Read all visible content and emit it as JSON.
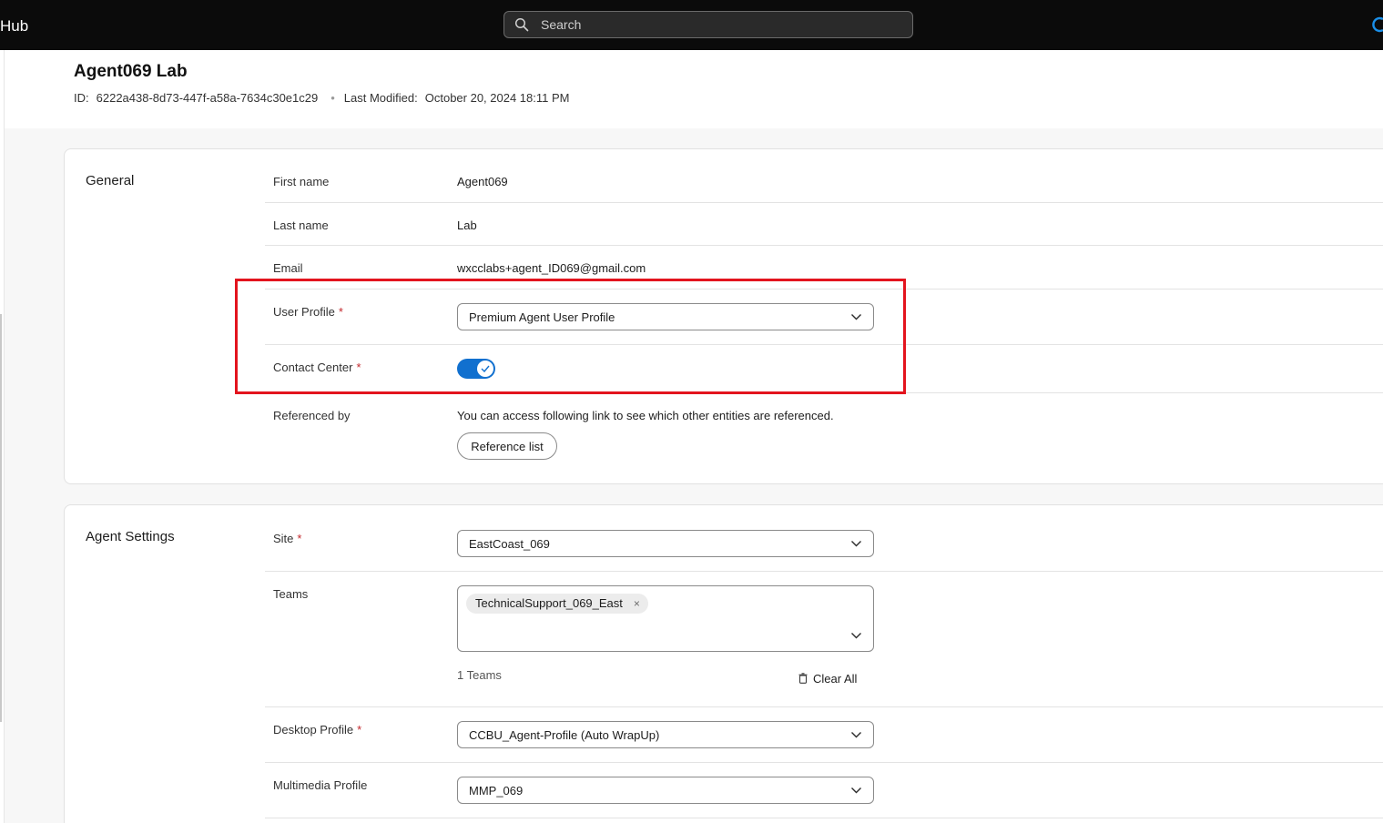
{
  "app": {
    "name": "Hub"
  },
  "search": {
    "placeholder": "Search"
  },
  "header": {
    "title": "Agent069 Lab",
    "id_label": "ID:",
    "id_value": "6222a438-8d73-447f-a58a-7634c30e1c29",
    "modified_label": "Last Modified:",
    "modified_value": "October 20, 2024 18:11 PM"
  },
  "general": {
    "title": "General",
    "first_name": {
      "label": "First name",
      "value": "Agent069"
    },
    "last_name": {
      "label": "Last name",
      "value": "Lab"
    },
    "email": {
      "label": "Email",
      "value": "wxcclabs+agent_ID069@gmail.com"
    },
    "user_profile": {
      "label": "User Profile",
      "required": "*",
      "value": "Premium Agent User Profile"
    },
    "contact_center": {
      "label": "Contact Center",
      "required": "*",
      "enabled": true
    },
    "referenced_by": {
      "label": "Referenced by",
      "text": "You can access following link to see which other entities are referenced.",
      "button": "Reference list"
    }
  },
  "agent_settings": {
    "title": "Agent Settings",
    "site": {
      "label": "Site",
      "required": "*",
      "value": "EastCoast_069"
    },
    "teams": {
      "label": "Teams",
      "chips": [
        "TechnicalSupport_069_East"
      ],
      "chip_remove": "×",
      "count": "1 Teams",
      "clear_all": "Clear All"
    },
    "desktop_profile": {
      "label": "Desktop Profile",
      "required": "*",
      "value": "CCBU_Agent-Profile (Auto WrapUp)"
    },
    "multimedia_profile": {
      "label": "Multimedia Profile",
      "value": "MMP_069"
    }
  },
  "colors": {
    "topbar": "#0b0b0b",
    "accent": "#1170cf",
    "required": "#c3292e",
    "highlight": "#e3141e"
  }
}
